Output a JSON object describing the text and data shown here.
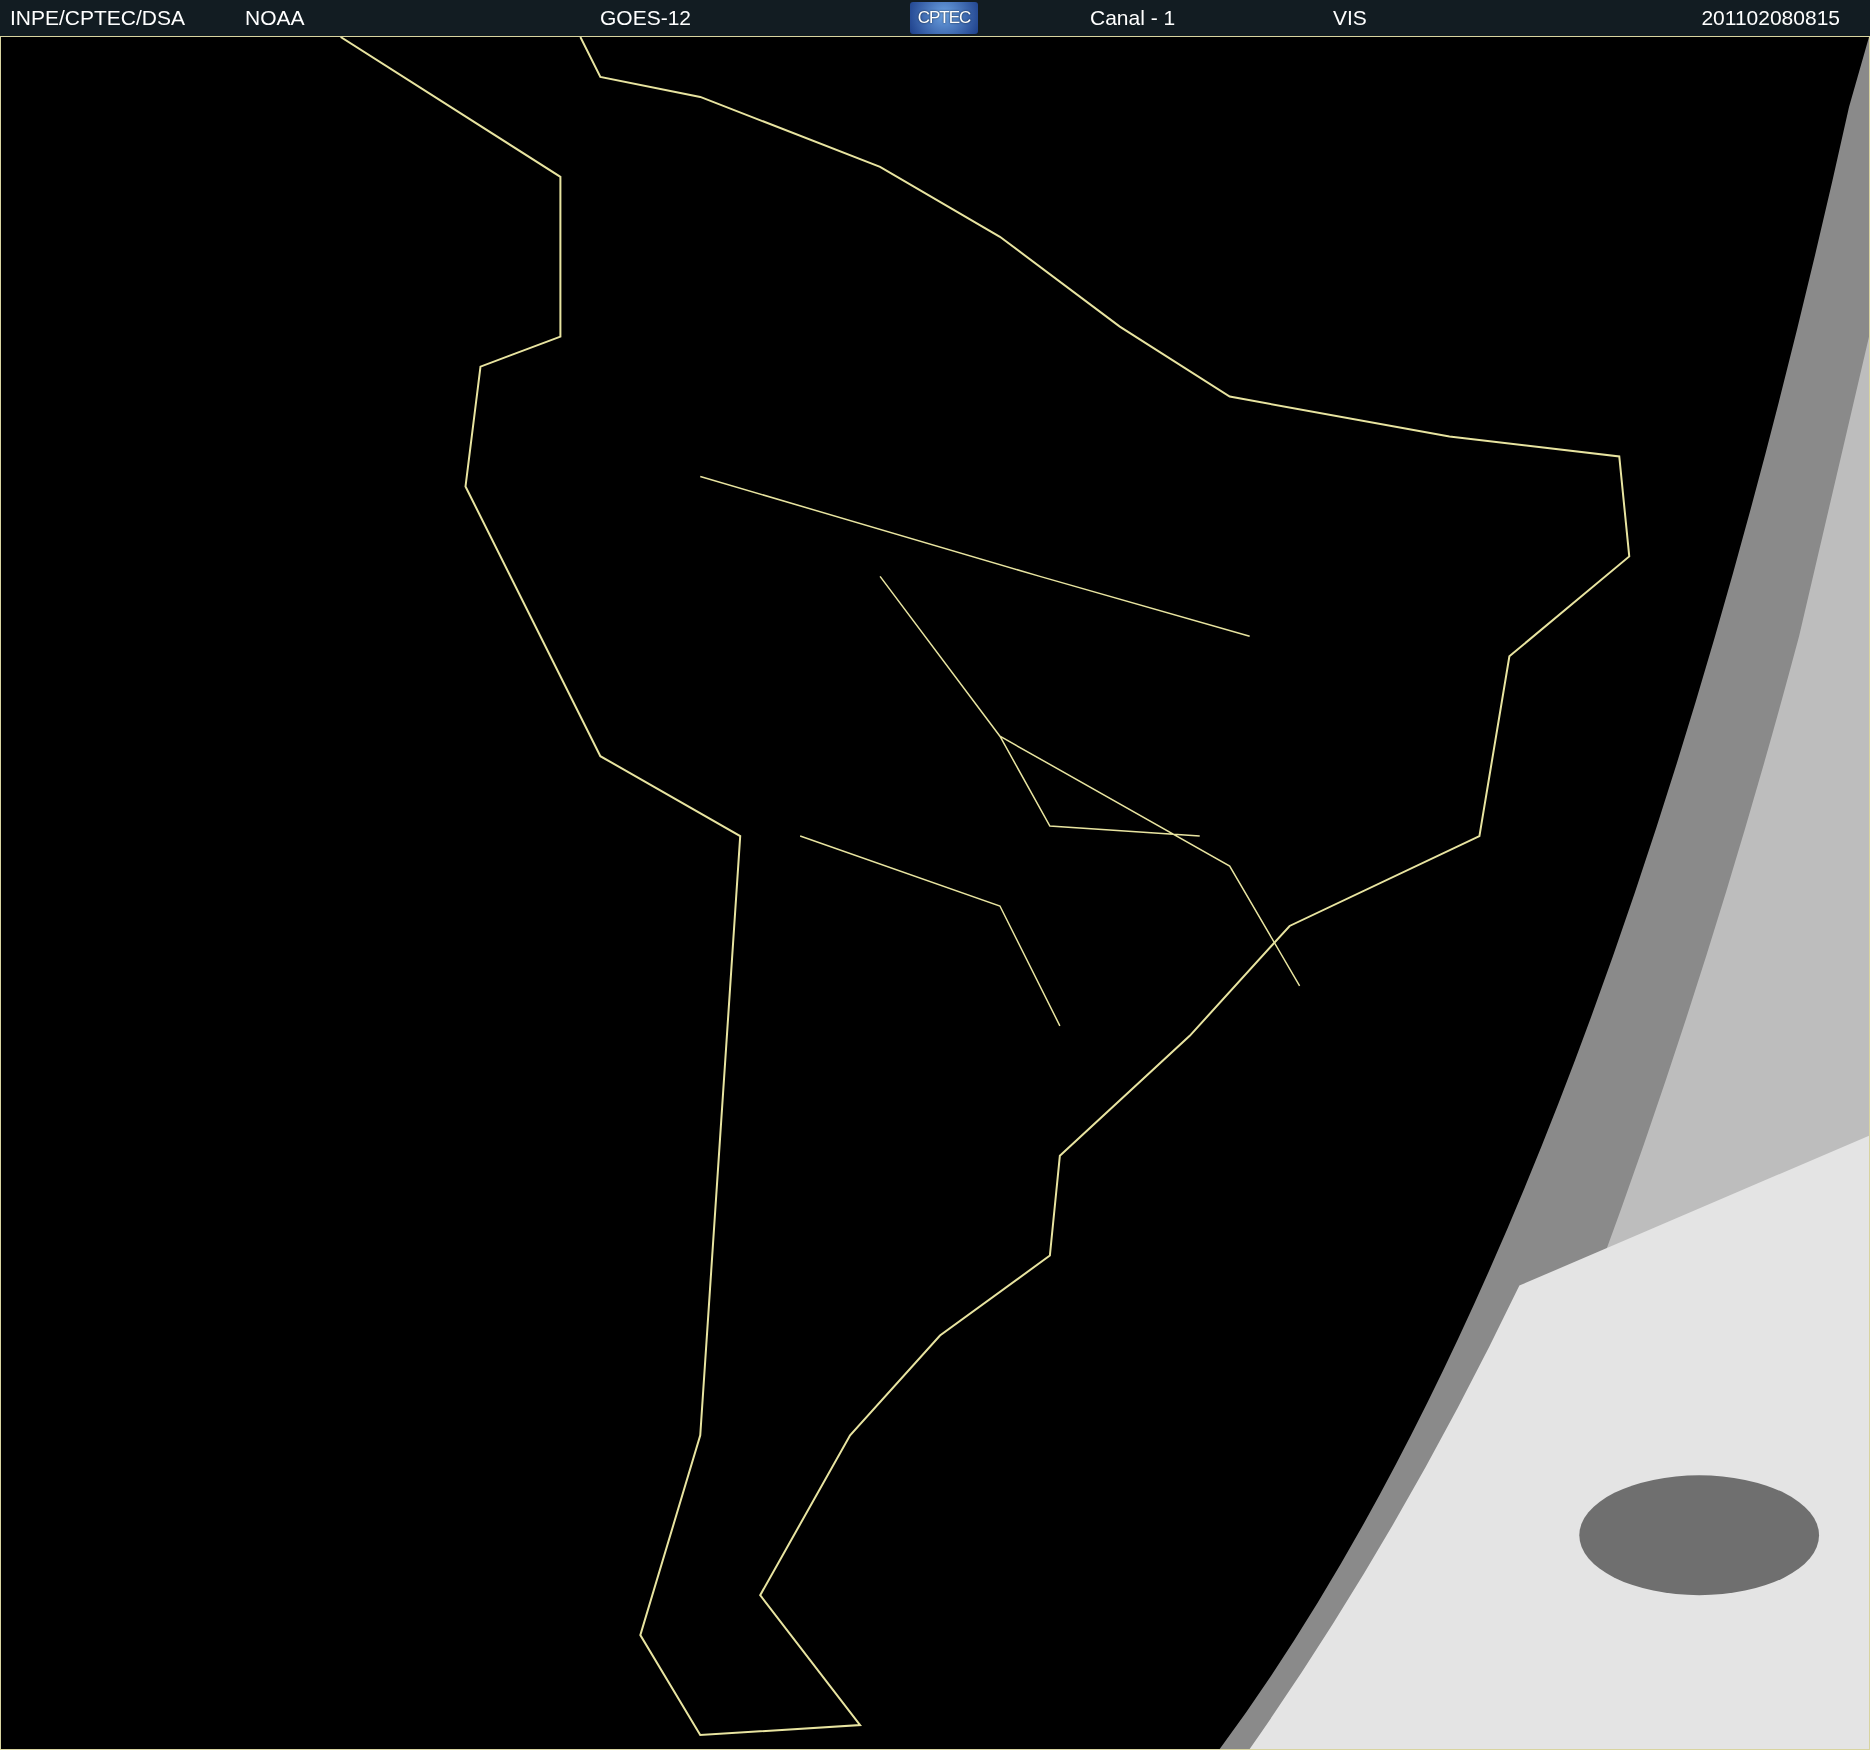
{
  "header": {
    "source": "INPE/CPTEC/DSA",
    "agency": "NOAA",
    "satellite": "GOES-12",
    "logo": "CPTEC",
    "channel": "Canal - 1",
    "band": "VIS",
    "timestamp": "201102080815"
  }
}
